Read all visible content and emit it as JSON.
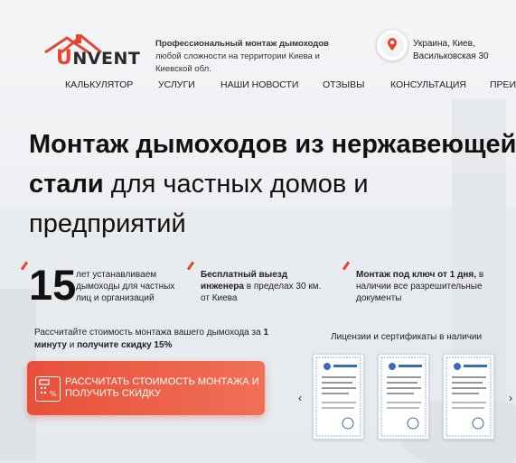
{
  "brand": {
    "logo_initial": "U",
    "logo_rest": "NVENT"
  },
  "tagline": {
    "bold": "Профессиональный монтаж дымоходов",
    "rest": " любой сложности на территории Киева и Киевской обл."
  },
  "address": {
    "line1": "Украина, Киев,",
    "line2": "Васильковская 30"
  },
  "nav": [
    "КАЛЬКУЛЯТОР",
    "УСЛУГИ",
    "НАШИ НОВОСТИ",
    "ОТЗЫВЫ",
    "КОНСУЛЬТАЦИЯ",
    "ПРЕИ"
  ],
  "hero": {
    "line1": "Монтаж дымоходов из нержавеющей",
    "line2_bold": "стали",
    "line2_rest": " для частных домов и",
    "line3": "предприятий"
  },
  "stats": {
    "years": "15",
    "years_text": "лет устанавливаем дымоходы для частных лиц и организаций",
    "visit_bold": "Бесплатный выезд инженера",
    "visit_rest": " в пределах 30 км. от Киева",
    "turnkey_bold": "Монтаж под ключ от 1 дня,",
    "turnkey_rest": " в наличии все разрешительные документы"
  },
  "calc": {
    "part1": "Рассчитайте стоимость монтажа вашего дымохода за ",
    "bold1": "1 минуту",
    "part2": " и ",
    "bold2": "получите скидку 15%"
  },
  "cta": {
    "label": "РАССЧИТАТЬ СТОИМОСТЬ МОНТАЖА И ПОЛУЧИТЬ СКИДКУ"
  },
  "licenses": {
    "title": "Лицензии и сертификаты в наличии",
    "prev": "‹",
    "next": "›"
  },
  "colors": {
    "accent": "#e5442f",
    "text": "#111111"
  }
}
